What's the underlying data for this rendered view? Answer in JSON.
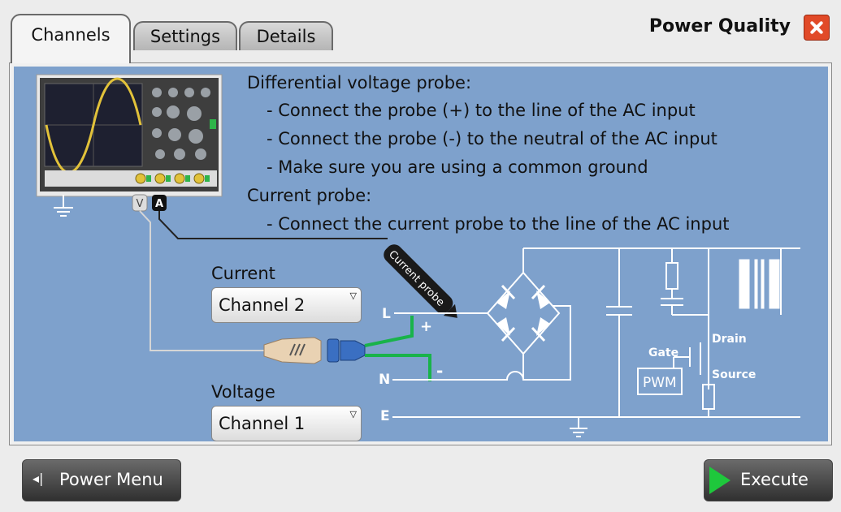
{
  "tabs": [
    {
      "label": "Channels",
      "active": true
    },
    {
      "label": "Settings",
      "active": false
    },
    {
      "label": "Details",
      "active": false
    }
  ],
  "window_title": "Power Quality",
  "instructions": [
    "Differential voltage probe:",
    "- Connect the probe (+) to the line of the AC input",
    "- Connect the probe (-) to the neutral of the AC input",
    "- Make sure you are using a common ground",
    "Current probe:",
    "- Connect the current probe to the line of the AC input"
  ],
  "current": {
    "label": "Current",
    "value": "Channel 2"
  },
  "voltage": {
    "label": "Voltage",
    "value": "Channel 1"
  },
  "diagram": {
    "current_probe": "Current probe",
    "v_marker": "V",
    "a_marker": "A",
    "line_L": "L",
    "line_N": "N",
    "line_E": "E",
    "plus": "+",
    "minus": "-",
    "gate": "Gate",
    "drain": "Drain",
    "source": "Source",
    "pwm": "PWM"
  },
  "buttons": {
    "power_menu": "Power Menu",
    "execute": "Execute"
  },
  "colors": {
    "panel_blue": "#7ea1cc",
    "probe_green": "#19b34a",
    "close_red": "#e14a28"
  }
}
